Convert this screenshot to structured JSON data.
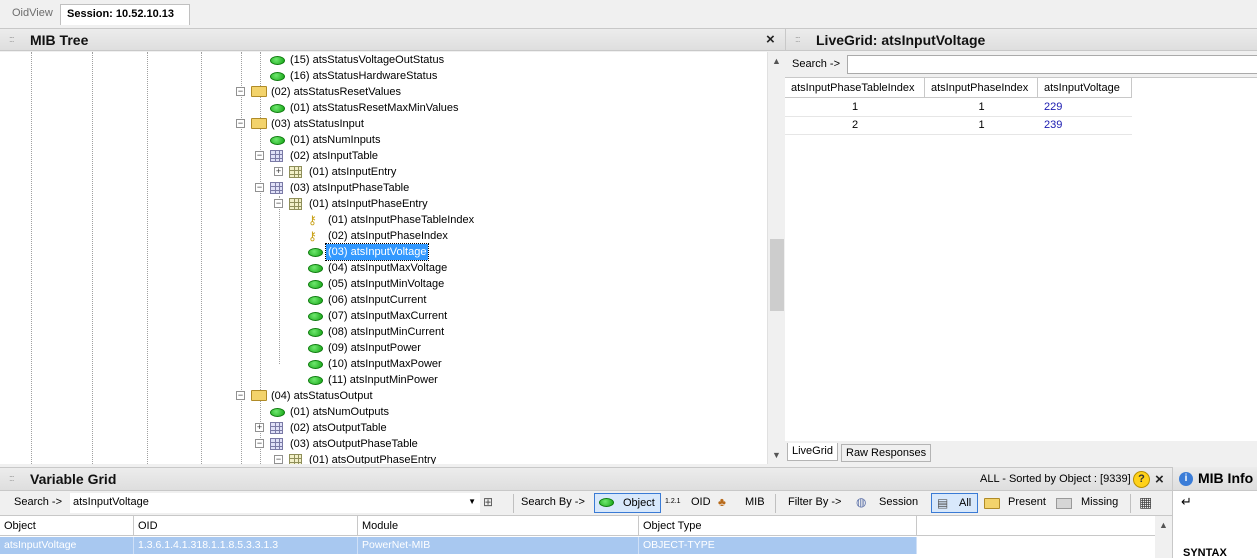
{
  "tabs": {
    "oidview": "OidView",
    "session": "Session: 10.52.10.13"
  },
  "mib_tree": {
    "title": "MIB Tree",
    "close": "×",
    "nodes": [
      {
        "label": "(15) atsStatusVoltageOutStatus",
        "icon": "leaf-icon",
        "level": 6
      },
      {
        "label": "(16) atsStatusHardwareStatus",
        "icon": "leaf-icon",
        "level": 6
      },
      {
        "label": "(02) atsStatusResetValues",
        "icon": "folder-icon",
        "level": 5,
        "expander": "−"
      },
      {
        "label": "(01) atsStatusResetMaxMinValues",
        "icon": "leaf-icon",
        "level": 6
      },
      {
        "label": "(03) atsStatusInput",
        "icon": "folder-icon",
        "level": 5,
        "expander": "−"
      },
      {
        "label": "(01) atsNumInputs",
        "icon": "leaf-icon",
        "level": 6
      },
      {
        "label": "(02) atsInputTable",
        "icon": "table-icon",
        "level": 6,
        "expander": "−"
      },
      {
        "label": "(01) atsInputEntry",
        "icon": "entry-icon",
        "level": 7,
        "expander": "+"
      },
      {
        "label": "(03) atsInputPhaseTable",
        "icon": "table-icon",
        "level": 6,
        "expander": "−"
      },
      {
        "label": "(01) atsInputPhaseEntry",
        "icon": "entry-icon",
        "level": 7,
        "expander": "−"
      },
      {
        "label": "(01) atsInputPhaseTableIndex",
        "icon": "key-icon",
        "level": 8
      },
      {
        "label": "(02) atsInputPhaseIndex",
        "icon": "key-icon",
        "level": 8
      },
      {
        "label": "(03) atsInputVoltage",
        "icon": "leaf-icon",
        "level": 8,
        "selected": true
      },
      {
        "label": "(04) atsInputMaxVoltage",
        "icon": "leaf-icon",
        "level": 8
      },
      {
        "label": "(05) atsInputMinVoltage",
        "icon": "leaf-icon",
        "level": 8
      },
      {
        "label": "(06) atsInputCurrent",
        "icon": "leaf-icon",
        "level": 8
      },
      {
        "label": "(07) atsInputMaxCurrent",
        "icon": "leaf-icon",
        "level": 8
      },
      {
        "label": "(08) atsInputMinCurrent",
        "icon": "leaf-icon",
        "level": 8
      },
      {
        "label": "(09) atsInputPower",
        "icon": "leaf-icon",
        "level": 8
      },
      {
        "label": "(10) atsInputMaxPower",
        "icon": "leaf-icon",
        "level": 8
      },
      {
        "label": "(11) atsInputMinPower",
        "icon": "leaf-icon",
        "level": 8
      },
      {
        "label": "(04) atsStatusOutput",
        "icon": "folder-icon",
        "level": 5,
        "expander": "−"
      },
      {
        "label": "(01) atsNumOutputs",
        "icon": "leaf-icon",
        "level": 6
      },
      {
        "label": "(02) atsOutputTable",
        "icon": "table-icon",
        "level": 6,
        "expander": "+"
      },
      {
        "label": "(03) atsOutputPhaseTable",
        "icon": "table-icon",
        "level": 6,
        "expander": "−"
      },
      {
        "label": "(01) atsOutputPhaseEntry",
        "icon": "entry-icon",
        "level": 7,
        "expander": "−"
      }
    ]
  },
  "livegrid": {
    "title": "LiveGrid: atsInputVoltage",
    "search_label": "Search ->",
    "search_value": "",
    "columns": [
      "atsInputPhaseTableIndex",
      "atsInputPhaseIndex",
      "atsInputVoltage"
    ],
    "rows": [
      [
        "1",
        "1",
        "229"
      ],
      [
        "2",
        "1",
        "239"
      ]
    ],
    "tabs": [
      "LiveGrid",
      "Raw Responses"
    ]
  },
  "variable_grid": {
    "title": "Variable Grid",
    "status": "ALL - Sorted by Object : [9339]",
    "search_label": "Search ->",
    "search_value": "atsInputVoltage",
    "search_by_label": "Search By ->",
    "search_by_options": [
      "Object",
      "OID",
      "MIB"
    ],
    "oid_prefix_glyph": "1.2.1",
    "filter_by_label": "Filter By ->",
    "filter_options": [
      "Session",
      "All",
      "Present",
      "Missing"
    ],
    "columns": [
      "Object",
      "OID",
      "Module",
      "Object Type"
    ],
    "rows": [
      [
        "atsInputVoltage",
        "1.3.6.1.4.1.318.1.1.8.5.3.3.1.3",
        "PowerNet-MIB",
        "OBJECT-TYPE"
      ]
    ]
  },
  "mib_info": {
    "title": "MIB Info",
    "syntax_label": "SYNTAX"
  },
  "colors": {
    "selection": "#3399ff",
    "row_highlight": "#a8c8f0",
    "leaf": "#13a313"
  }
}
